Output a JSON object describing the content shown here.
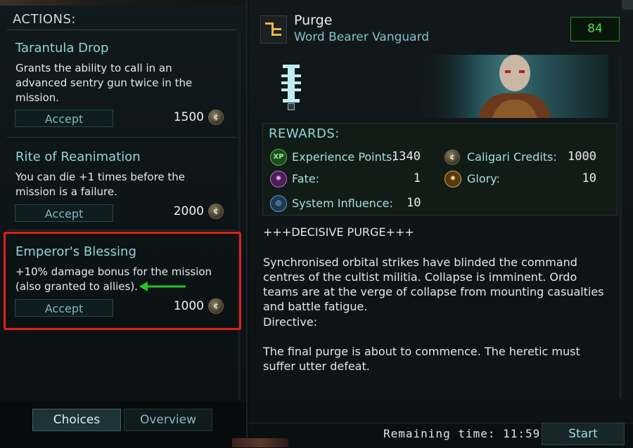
{
  "colors": {
    "accent_teal": "#8fd6dc",
    "highlight_red": "#e0201c",
    "arrow_green": "#22c42b",
    "level_green": "#58d65a"
  },
  "left": {
    "heading": "ACTIONS:",
    "actions": [
      {
        "title": "Tarantula Drop",
        "description": "Grants the ability to call in an advanced sentry gun twice in the mission.",
        "button": "Accept",
        "cost": "1500",
        "icon": "credits-coin-icon"
      },
      {
        "title": "Rite of Reanimation",
        "description": "You can die +1 times before the mission is a failure.",
        "button": "Accept",
        "cost": "2000",
        "icon": "credits-coin-icon"
      },
      {
        "title": "Emperor's Blessing",
        "description": "+10% damage bonus for the mission (also granted to allies).",
        "button": "Accept",
        "cost": "1000",
        "icon": "credits-coin-icon"
      }
    ],
    "tabs": {
      "choices": "Choices",
      "overview": "Overview"
    }
  },
  "mission": {
    "title": "Purge",
    "subtitle": "Word Bearer Vanguard",
    "level": "84",
    "rewards_heading": "REWARDS:",
    "rewards": {
      "xp": {
        "label": "Experience Points:",
        "value": "1340",
        "icon": "xp-icon"
      },
      "fate": {
        "label": "Fate:",
        "value": "1",
        "icon": "fate-icon"
      },
      "influence": {
        "label": "System Influence:",
        "value": "10",
        "icon": "planet-icon"
      },
      "credits": {
        "label": "Caligari Credits:",
        "value": "1000",
        "icon": "credits-coin-icon"
      },
      "glory": {
        "label": "Glory:",
        "value": "10",
        "icon": "glory-icon"
      }
    },
    "description": {
      "header": "+++DECISIVE PURGE+++",
      "para1": "Synchronised orbital strikes have blinded the command centres of the cultist militia. Collapse is imminent. Ordo teams are at the verge of collapse from mounting casualties and battle fatigue.",
      "directive_label": "Directive:",
      "para2": "The final purge is about to commence. The heretic must suffer utter defeat."
    }
  },
  "footer": {
    "remaining_time": "Remaining time: 11:59",
    "start": "Start"
  }
}
